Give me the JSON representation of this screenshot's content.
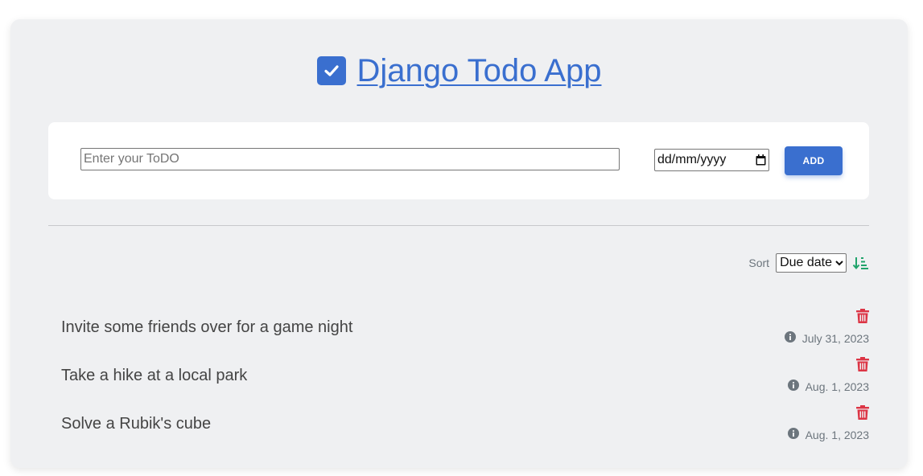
{
  "header": {
    "title": "Django Todo App"
  },
  "form": {
    "todo_placeholder": "Enter your ToDO",
    "todo_value": "",
    "date_placeholder": "dd/mm/yyyy",
    "add_label": "ADD"
  },
  "sort": {
    "label": "Sort",
    "selected": "Due date"
  },
  "todos": [
    {
      "text": "Invite some friends over for a game night",
      "due": "July 31, 2023"
    },
    {
      "text": "Take a hike at a local park",
      "due": "Aug. 1, 2023"
    },
    {
      "text": "Solve a Rubik's cube",
      "due": "Aug. 1, 2023"
    }
  ],
  "icons": {
    "title": "checkbox-icon",
    "date": "calendar-icon",
    "select": "chevron-down-icon",
    "sort": "sort-amount-down-icon",
    "delete": "trash-icon",
    "info": "info-circle-icon"
  },
  "colors": {
    "accent": "#3a6fcf",
    "delete": "#dc3545",
    "sort_icon": "#20a36b",
    "muted": "#6c757d"
  }
}
